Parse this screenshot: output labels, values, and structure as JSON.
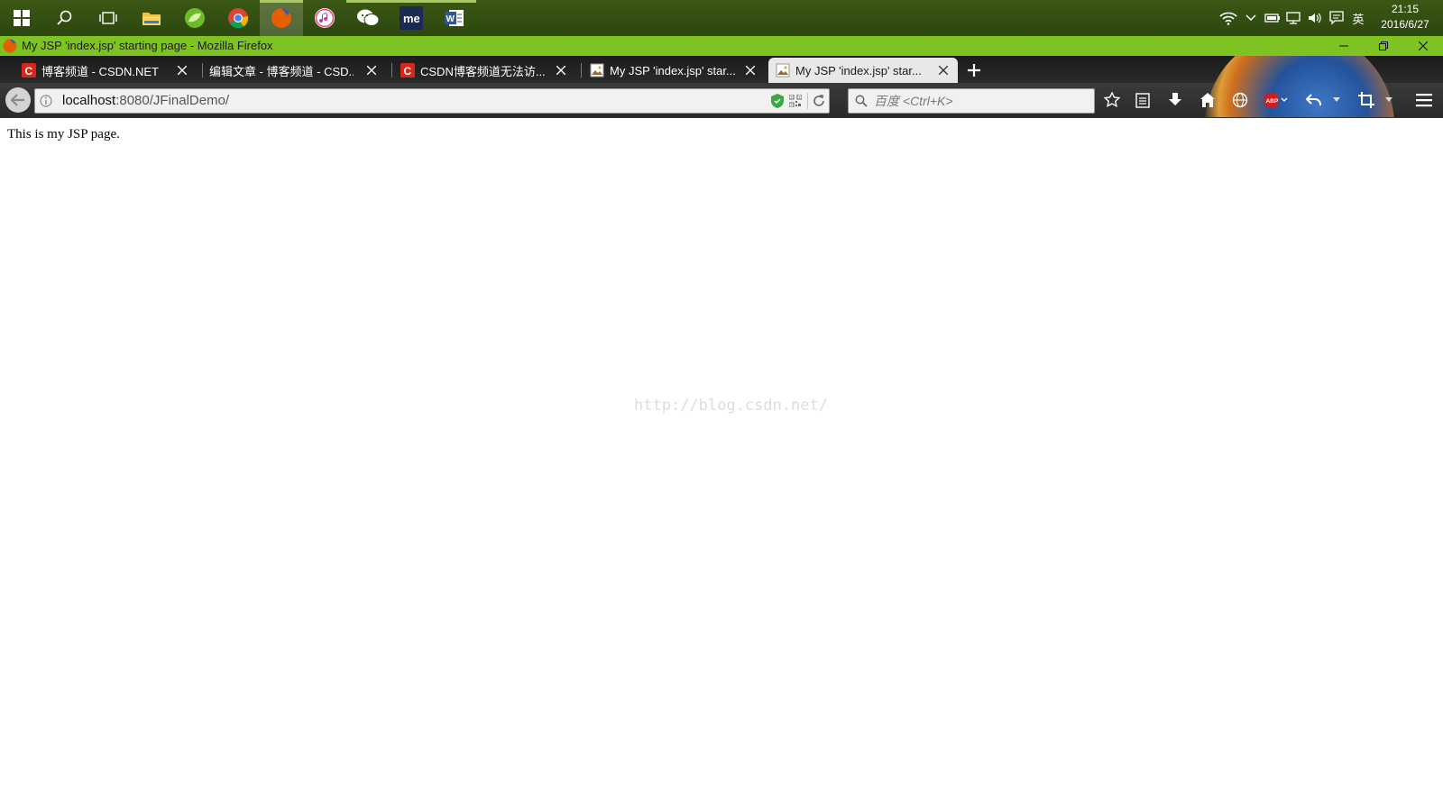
{
  "taskbar": {
    "clock": {
      "time": "21:15",
      "date": "2016/6/27"
    },
    "ime": "英"
  },
  "window": {
    "title": "My JSP 'index.jsp' starting page - Mozilla Firefox"
  },
  "tabs": [
    {
      "label": "博客频道 - CSDN.NET"
    },
    {
      "label": "编辑文章 - 博客频道 - CSD..."
    },
    {
      "label": "CSDN博客频道无法访..."
    },
    {
      "label": "My JSP 'index.jsp' star..."
    },
    {
      "label": "My JSP 'index.jsp' star..."
    }
  ],
  "navbar": {
    "url_host": "localhost",
    "url_rest": ":8080/JFinalDemo/",
    "search_placeholder": "百度 <Ctrl+K>"
  },
  "content": {
    "body_text": "This is my JSP page.",
    "watermark": "http://blog.csdn.net/"
  },
  "colors": {
    "taskbar": "#2d4710",
    "titlebar": "#7ec322",
    "csdn_red": "#d9261c"
  }
}
